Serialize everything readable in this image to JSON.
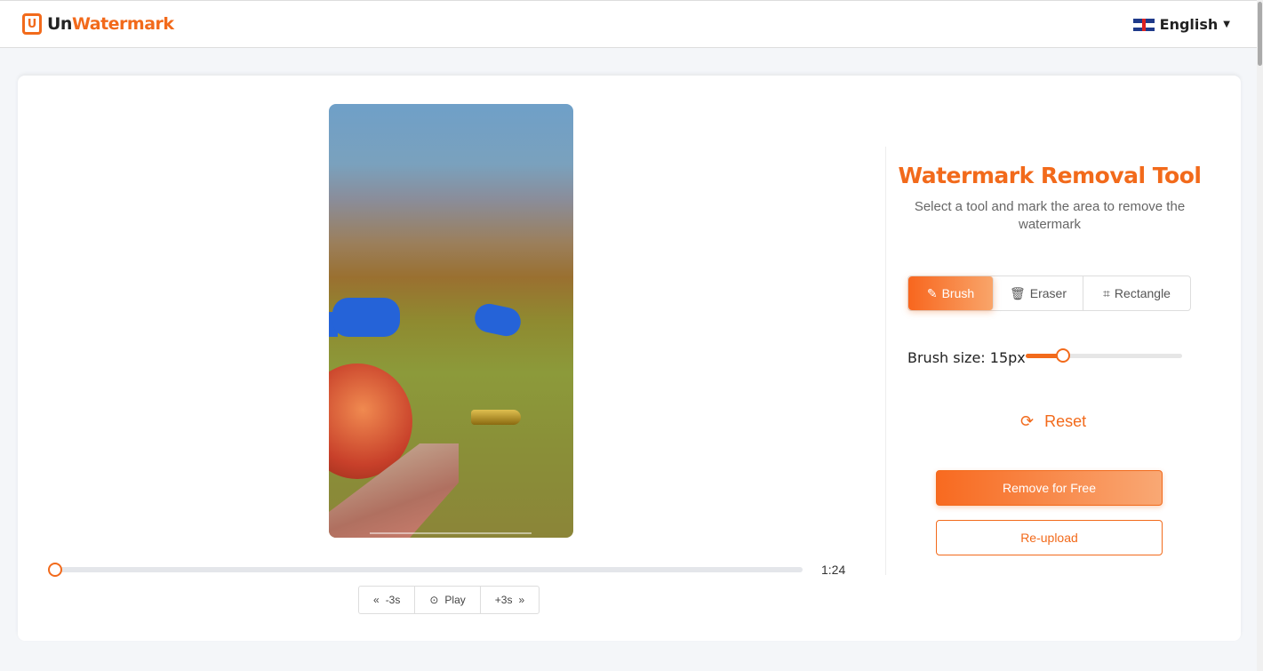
{
  "header": {
    "brand_prefix": "Un",
    "brand_suffix": "Watermark",
    "logo_letter": "U",
    "language": "English"
  },
  "player": {
    "current_time": "1:24",
    "progress_percent": 0,
    "back_label": "-3s",
    "play_label": "Play",
    "forward_label": "+3s"
  },
  "panel": {
    "title": "Watermark Removal Tool",
    "subtitle": "Select a tool and mark the area to remove the watermark",
    "tools": [
      {
        "label": "Brush",
        "icon": "pencil-icon",
        "active": true
      },
      {
        "label": "Eraser",
        "icon": "trash-icon",
        "active": false
      },
      {
        "label": "Rectangle",
        "icon": "crop-icon",
        "active": false
      }
    ],
    "brush_size_label": "Brush size: 15px",
    "brush_size_percent": 24,
    "reset_label": "Reset",
    "remove_label": "Remove for Free",
    "reupload_label": "Re-upload"
  },
  "colors": {
    "accent": "#f26a1b",
    "mask": "#2563d8"
  }
}
